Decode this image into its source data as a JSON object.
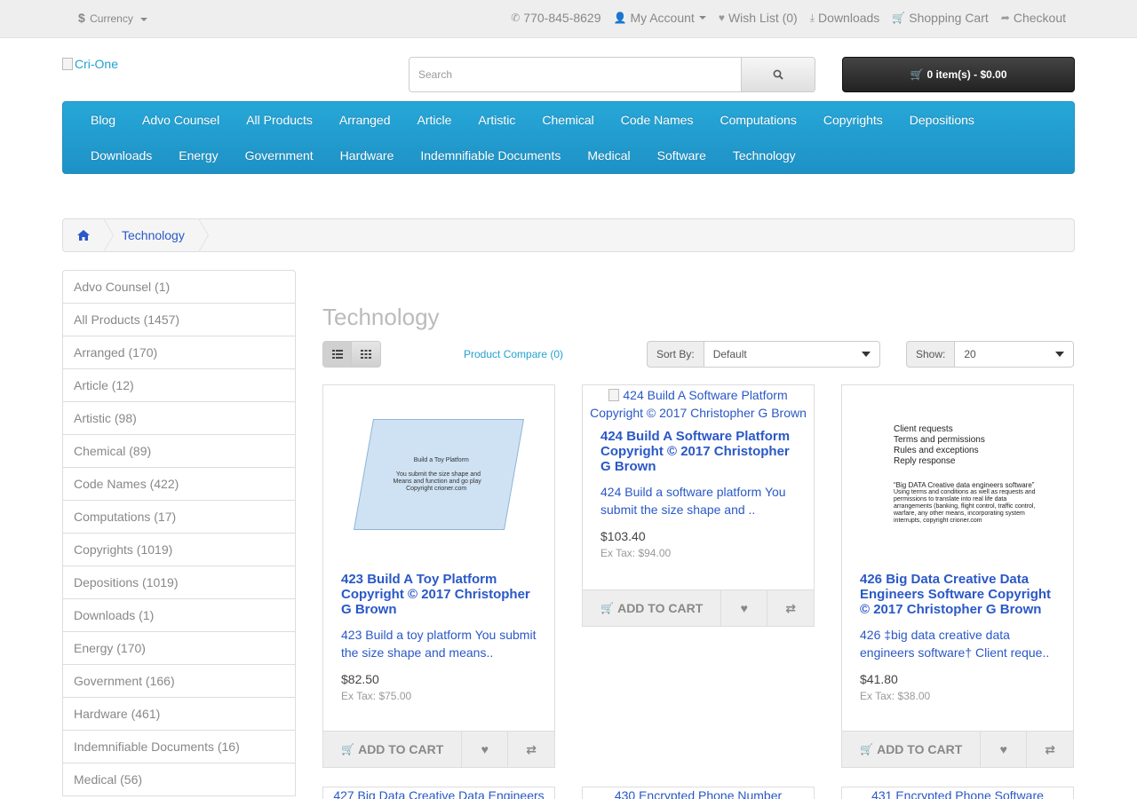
{
  "topbar": {
    "currency_symbol": "$",
    "currency_label": "Currency",
    "phone": "770-845-8629",
    "my_account": "My Account",
    "wishlist": "Wish List (0)",
    "downloads": "Downloads",
    "shopping_cart": "Shopping Cart",
    "checkout": "Checkout"
  },
  "header": {
    "logo_alt": "Cri-One",
    "search_placeholder": "Search",
    "cart_button": "0 item(s) - $0.00"
  },
  "menu": {
    "row1": [
      "Blog",
      "Advo Counsel",
      "All Products",
      "Arranged",
      "Article",
      "Artistic",
      "Chemical",
      "Code Names",
      "Computations",
      "Copyrights",
      "Depositions"
    ],
    "row2": [
      "Downloads",
      "Energy",
      "Government",
      "Hardware",
      "Indemnifiable Documents",
      "Medical",
      "Software",
      "Technology"
    ]
  },
  "breadcrumb": {
    "current": "Technology"
  },
  "sidebar": {
    "categories": [
      "Advo Counsel (1)",
      "All Products (1457)",
      "Arranged (170)",
      "Article (12)",
      "Artistic (98)",
      "Chemical (89)",
      "Code Names (422)",
      "Computations (17)",
      "Copyrights (1019)",
      "Depositions (1019)",
      "Downloads (1)",
      "Energy (170)",
      "Government (166)",
      "Hardware (461)",
      "Indemnifiable Documents (16)",
      "Medical (56)"
    ]
  },
  "content": {
    "title": "Technology",
    "product_compare": "Product Compare (0)",
    "sort_label": "Sort By:",
    "sort_value": "Default",
    "show_label": "Show:",
    "show_value": "20"
  },
  "products": [
    {
      "title": "423 Build A Toy Platform Copyright © 2017 Christopher G Brown",
      "desc": "423 Build a toy platform You submit the size shape and means..",
      "price": "$82.50",
      "tax": "Ex Tax: $75.00",
      "image_lines": [
        "Build a Toy Platform",
        "You submit the size shape and",
        "Means and function and go play",
        "Copyright crioner.com"
      ]
    },
    {
      "title": "424 Build A Software Platform Copyright © 2017 Christopher G Brown",
      "alt": "424 Build A Software Platform Copyright © 2017 Christopher G Brown",
      "desc": "424 Build a software platform You submit the size shape and ..",
      "price": "$103.40",
      "tax": "Ex Tax: $94.00"
    },
    {
      "title": "426 Big Data Creative Data Engineers Software Copyright © 2017 Christopher G Brown",
      "desc": "426 ‡big data creative data engineers software† Client reque..",
      "price": "$41.80",
      "tax": "Ex Tax: $38.00",
      "image_lines": [
        "Client requests",
        "Terms and permissions",
        "Rules and exceptions",
        "Reply response",
        "“Big DATA Creative data engineers software”",
        "Using terms and conditions as well as requests and permissions to translate into real life data arrangements (banking, flight control, traffic control, warfare, any other means, incorporating system interrupts, copyright crioner.com"
      ]
    }
  ],
  "buttons": {
    "add_to_cart": "ADD TO CART"
  },
  "bottom_row": [
    "427 Big Data Creative Data Engineers",
    "430 Encrypted Phone Number",
    "431 Encrypted Phone Software"
  ]
}
